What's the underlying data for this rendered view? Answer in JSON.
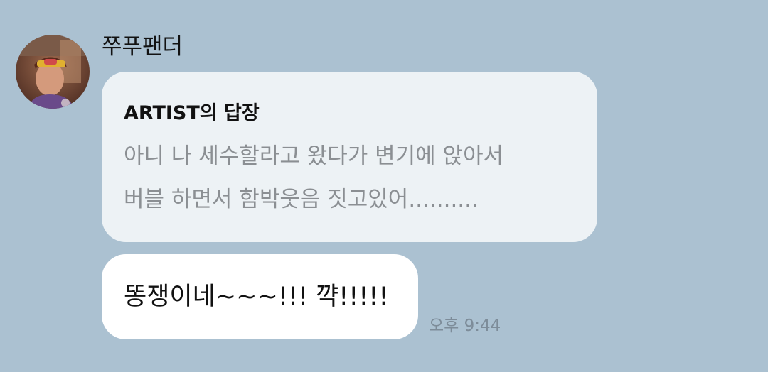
{
  "chat": {
    "sender_name": "쭈푸팬더",
    "avatar_icon": "profile-photo",
    "reply_bubble": {
      "title": "ARTIST의 답장",
      "line1": "아니 나 세수할라고 왔다가 변기에 앉아서",
      "line2": "버블 하면서 함박웃음 짓고있어.........."
    },
    "message": {
      "text": "똥쟁이네~~~!!!  꺅!!!!!",
      "time": "오후 9:44"
    }
  },
  "colors": {
    "background": "#abc1d1",
    "reply_bubble": "#edf2f5",
    "message_bubble": "#ffffff",
    "reply_text": "#8b8f93",
    "time_text": "#7d8c99"
  }
}
